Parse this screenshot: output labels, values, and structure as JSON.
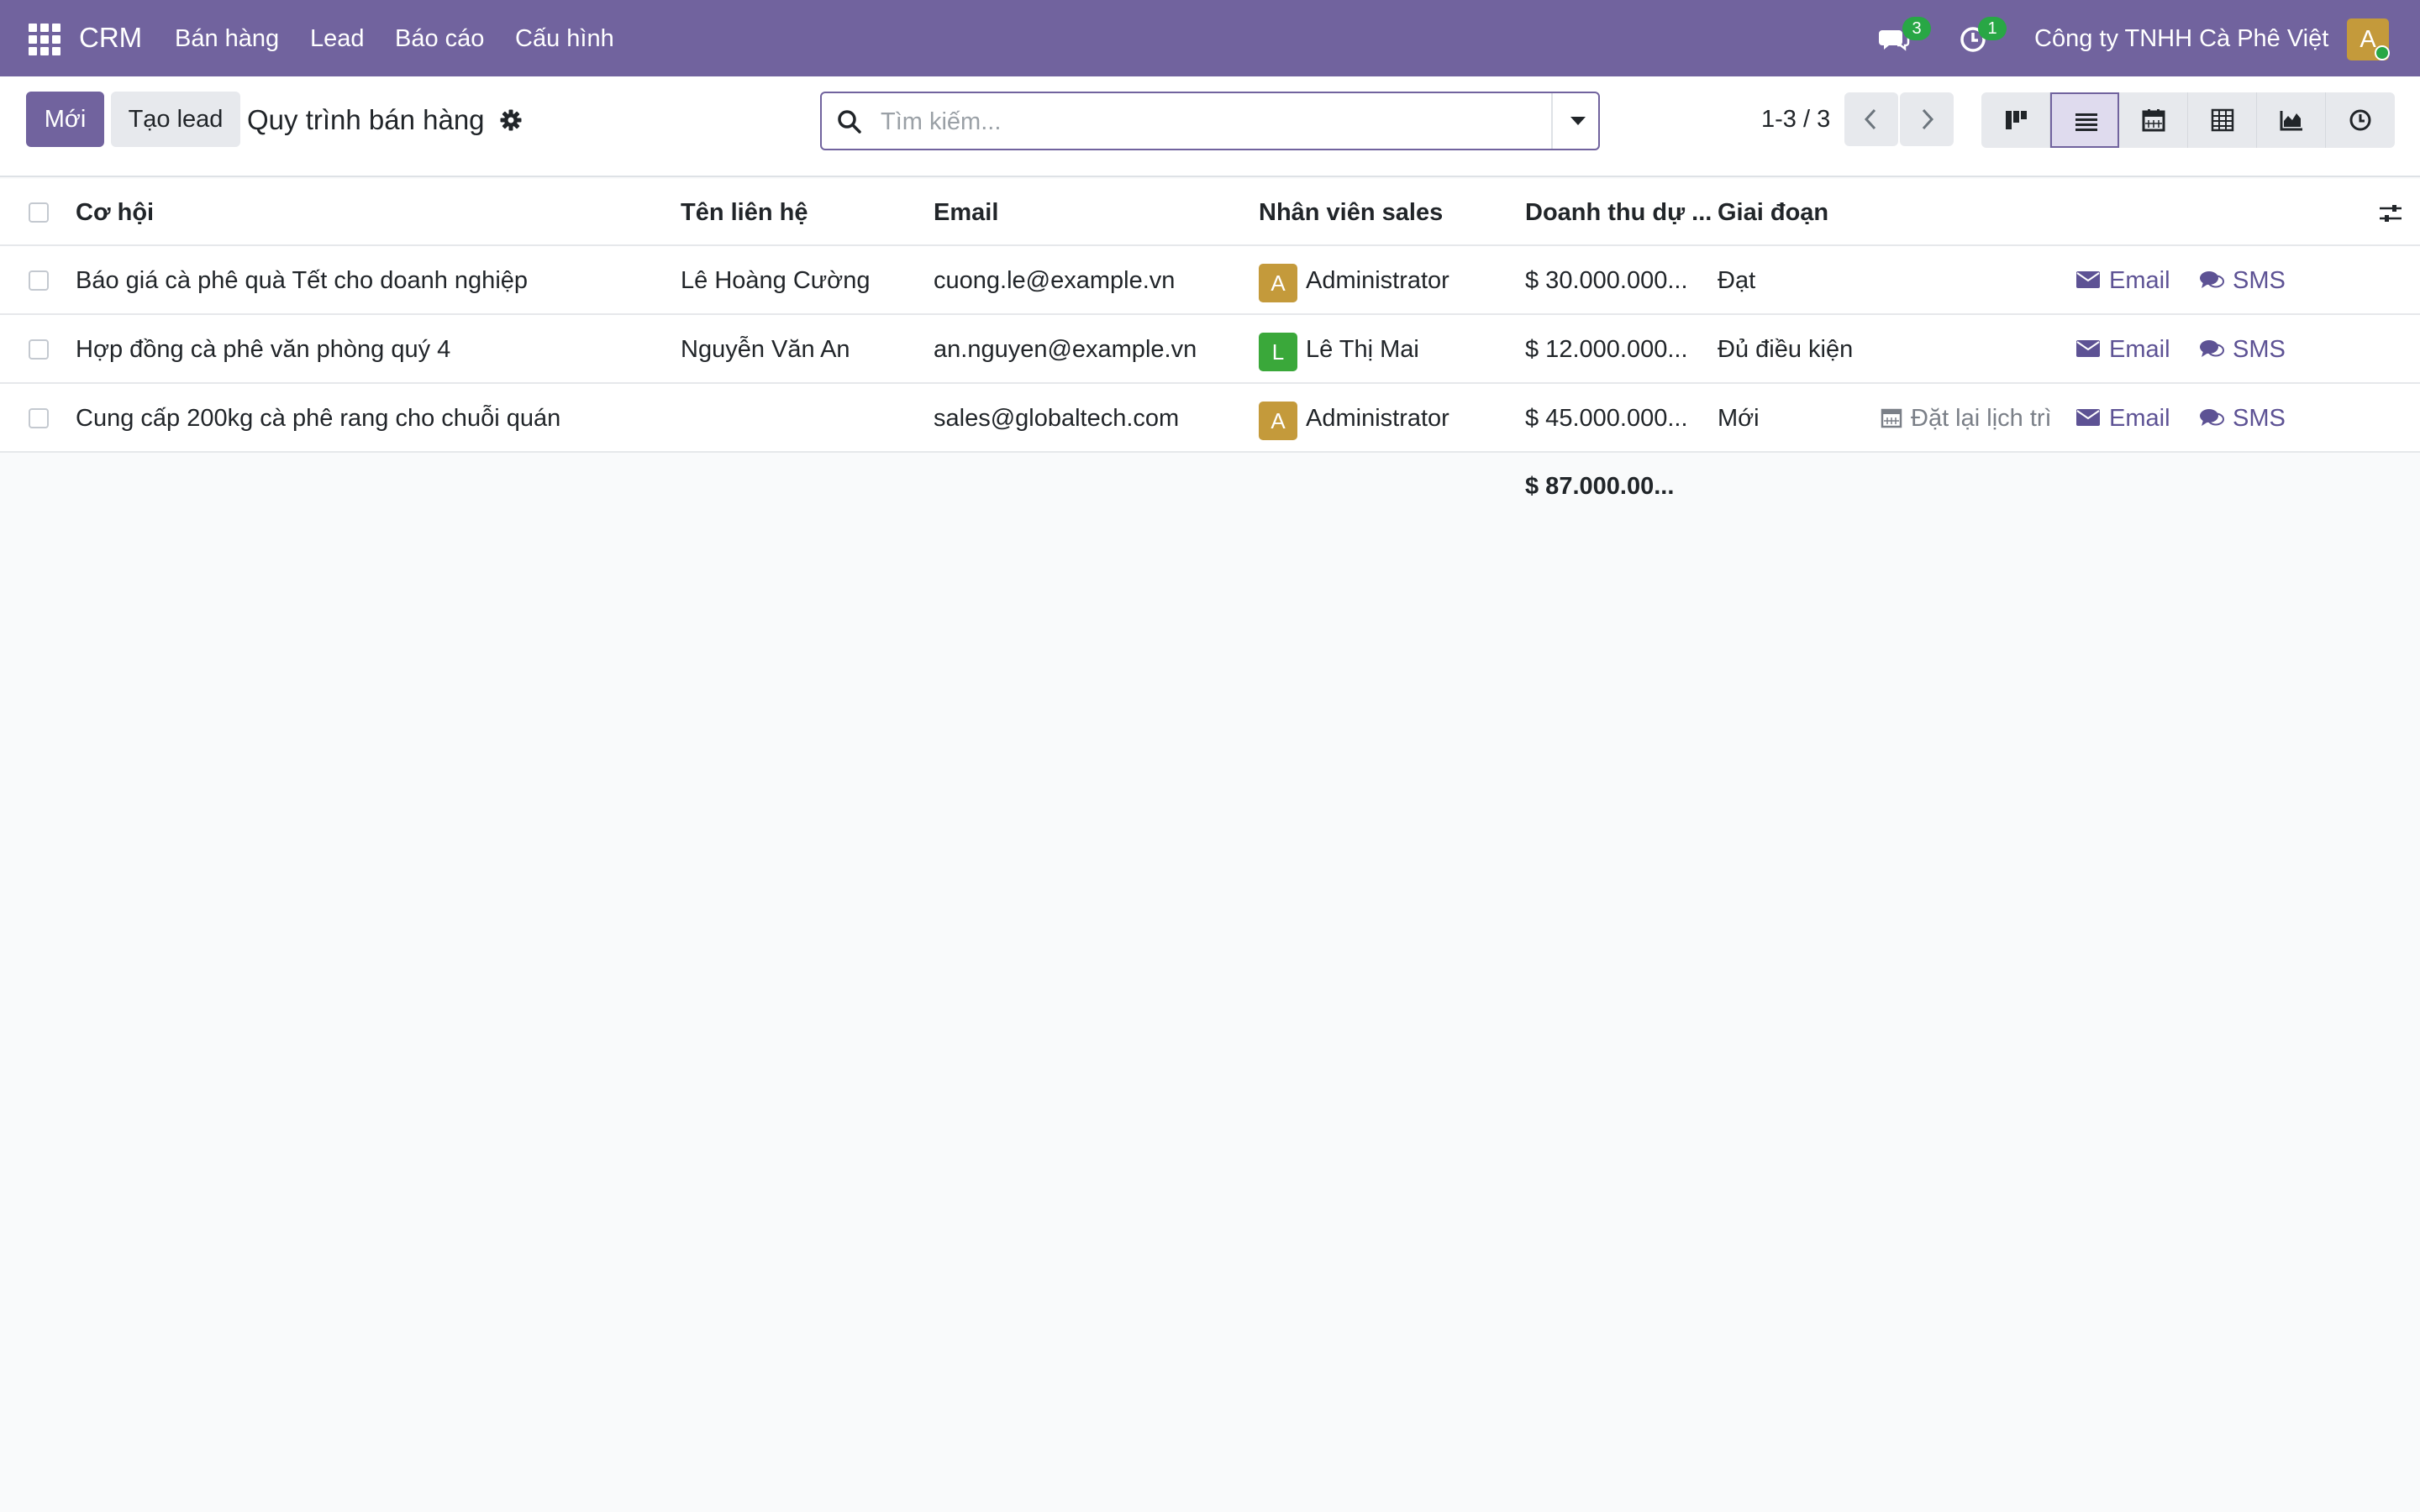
{
  "navbar": {
    "brand": "CRM",
    "menu": [
      "Bán hàng",
      "Lead",
      "Báo cáo",
      "Cấu hình"
    ],
    "messages_count": "3",
    "activities_count": "1",
    "company": "Công ty TNHH Cà Phê Việt",
    "user_initial": "A"
  },
  "control": {
    "new_label": "Mới",
    "create_lead_label": "Tạo lead",
    "title": "Quy trình bán hàng",
    "search_placeholder": "Tìm kiếm...",
    "pager": "1-3 / 3"
  },
  "table": {
    "columns": [
      "Cơ hội",
      "Tên liên hệ",
      "Email",
      "Nhân viên sales",
      "Doanh thu dự ...",
      "Giai đoạn"
    ],
    "rows": [
      {
        "opportunity": "Báo giá cà phê quà Tết cho doanh nghiệp",
        "contact": "Lê Hoàng Cường",
        "email": "cuong.le@example.vn",
        "salesperson_initial": "A",
        "salesperson": "Administrator",
        "revenue": "$ 30.000.000...",
        "stage": "Đạt",
        "reschedule": "",
        "action_email": "Email",
        "action_sms": "SMS"
      },
      {
        "opportunity": "Hợp đồng cà phê văn phòng quý 4",
        "contact": "Nguyễn Văn An",
        "email": "an.nguyen@example.vn",
        "salesperson_initial": "L",
        "salesperson": "Lê Thị Mai",
        "revenue": "$ 12.000.000...",
        "stage": "Đủ điều kiện",
        "reschedule": "",
        "action_email": "Email",
        "action_sms": "SMS"
      },
      {
        "opportunity": "Cung cấp 200kg cà phê rang cho chuỗi quán",
        "contact": "",
        "email": "sales@globaltech.com",
        "salesperson_initial": "A",
        "salesperson": "Administrator",
        "revenue": "$ 45.000.000...",
        "stage": "Mới",
        "reschedule": "Đặt lại lịch trì",
        "action_email": "Email",
        "action_sms": "SMS"
      }
    ],
    "total": "$ 87.000.00..."
  },
  "colors": {
    "brand": "#71639e",
    "avatar_admin": "#c49a3b",
    "avatar_mai": "#3aa83a",
    "badge": "#28a745",
    "action_link": "#5d5294"
  }
}
